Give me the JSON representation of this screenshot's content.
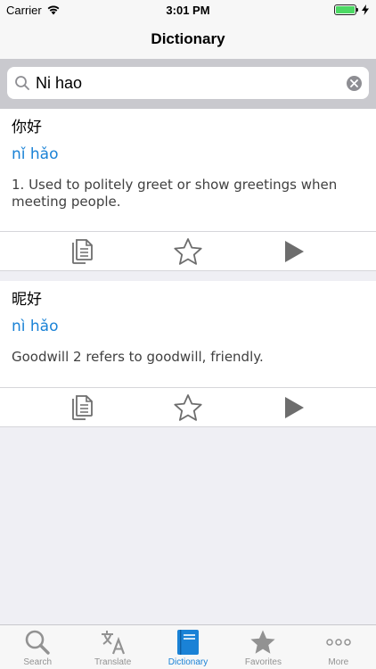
{
  "status_bar": {
    "carrier": "Carrier",
    "time": "3:01 PM",
    "battery_percent": 100
  },
  "nav": {
    "title": "Dictionary"
  },
  "search": {
    "value": "Ni hao"
  },
  "entries": [
    {
      "word": "你好",
      "pinyin": "nǐ hǎo",
      "definition": "1. Used to politely greet or show greetings when meeting people."
    },
    {
      "word": "昵好",
      "pinyin": "nì hǎo",
      "definition": "Goodwill 2 refers to goodwill, friendly."
    }
  ],
  "entry_actions": [
    "copy-icon",
    "star-icon",
    "play-icon"
  ],
  "tabs": [
    {
      "label": "Search",
      "icon": "search-icon",
      "active": false
    },
    {
      "label": "Translate",
      "icon": "translate-icon",
      "active": false
    },
    {
      "label": "Dictionary",
      "icon": "book-icon",
      "active": true
    },
    {
      "label": "Favorites",
      "icon": "star-icon",
      "active": false
    },
    {
      "label": "More",
      "icon": "more-icon",
      "active": false
    }
  ],
  "colors": {
    "accent": "#1a82d6",
    "inactive": "#929292",
    "battery": "#4cd964"
  }
}
